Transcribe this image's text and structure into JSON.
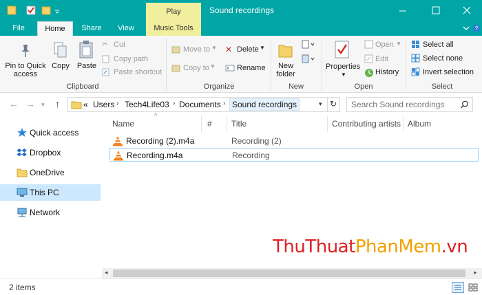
{
  "window": {
    "title": "Sound recordings",
    "contextual_tab": "Play",
    "accent_color": "#00a6a6",
    "contextual_color": "#f1ee9e"
  },
  "tabs": {
    "file": "File",
    "home": "Home",
    "share": "Share",
    "view": "View",
    "music_tools": "Music Tools"
  },
  "ribbon": {
    "clipboard": {
      "label": "Clipboard",
      "pin": "Pin to Quick access",
      "copy": "Copy",
      "paste": "Paste",
      "cut": "Cut",
      "copy_path": "Copy path",
      "paste_shortcut": "Paste shortcut"
    },
    "organize": {
      "label": "Organize",
      "move_to": "Move to",
      "copy_to": "Copy to",
      "delete": "Delete",
      "rename": "Rename"
    },
    "new": {
      "label": "New",
      "new_folder": "New folder"
    },
    "open": {
      "label": "Open",
      "properties": "Properties",
      "open": "Open",
      "edit": "Edit",
      "history": "History"
    },
    "select": {
      "label": "Select",
      "select_all": "Select all",
      "select_none": "Select none",
      "invert": "Invert selection"
    }
  },
  "address": {
    "overflow": "«",
    "crumbs": [
      "Users",
      "Tech4Life03",
      "Documents"
    ],
    "current": "Sound recordings",
    "search_placeholder": "Search Sound recordings"
  },
  "nav": {
    "items": [
      {
        "label": "Quick access",
        "icon": "star-icon"
      },
      {
        "label": "Dropbox",
        "icon": "dropbox-icon"
      },
      {
        "label": "OneDrive",
        "icon": "folder-icon"
      },
      {
        "label": "This PC",
        "icon": "computer-icon"
      },
      {
        "label": "Network",
        "icon": "network-icon"
      }
    ],
    "selected": "This PC"
  },
  "files": {
    "columns": [
      "Name",
      "#",
      "Title",
      "Contributing artists",
      "Album"
    ],
    "rows": [
      {
        "name": "Recording (2).m4a",
        "title": "Recording (2)"
      },
      {
        "name": "Recording.m4a",
        "title": "Recording"
      }
    ]
  },
  "watermark": {
    "part1": "ThuThuat",
    "part2": "PhanMem",
    "part3": ".vn"
  },
  "status": {
    "count": "2 items"
  }
}
